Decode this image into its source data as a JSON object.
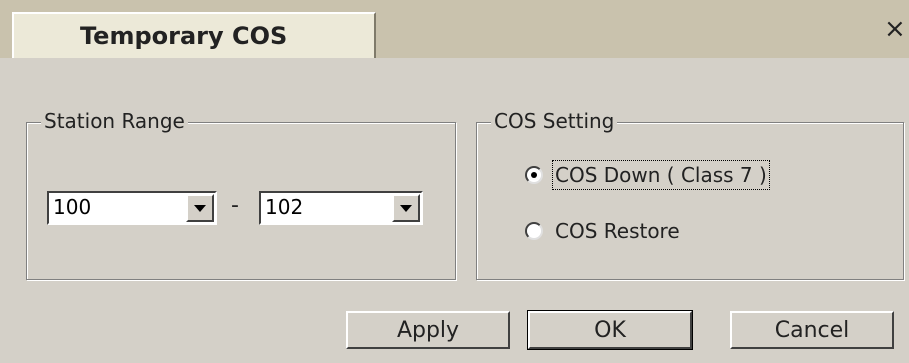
{
  "window": {
    "tab_title": "Temporary COS",
    "close_glyph": "×"
  },
  "station_range": {
    "label": "Station Range",
    "from_value": "100",
    "separator": "-",
    "to_value": "102"
  },
  "cos_setting": {
    "label": "COS Setting",
    "options": [
      {
        "label": "COS Down ( Class 7 )",
        "checked": true
      },
      {
        "label": "COS Restore",
        "checked": false
      }
    ]
  },
  "buttons": {
    "apply": "Apply",
    "ok": "OK",
    "cancel": "Cancel"
  }
}
